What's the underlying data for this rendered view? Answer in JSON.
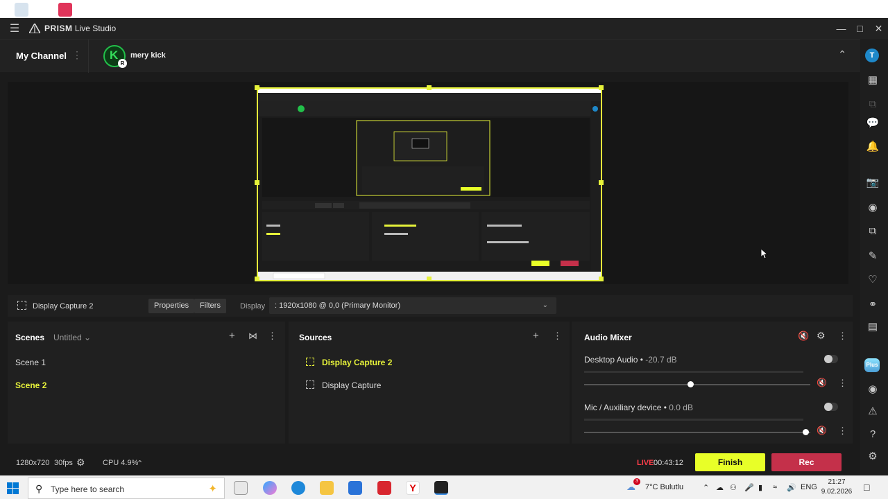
{
  "app": {
    "title_bold": "PRISM",
    "title_rest": " Live Studio"
  },
  "channel": {
    "label": "My Channel",
    "avatar_letter": "K",
    "avatar_badge": "R",
    "name": "mery kick"
  },
  "source_bar": {
    "source_name": "Display Capture 2",
    "properties_label": "Properties",
    "filters_label": "Filters",
    "display_label": "Display",
    "display_value": ": 1920x1080 @ 0,0 (Primary Monitor)"
  },
  "scenes": {
    "title": "Scenes",
    "collection": "Untitled",
    "items": [
      {
        "label": "Scene 1",
        "selected": false
      },
      {
        "label": "Scene 2",
        "selected": true
      }
    ]
  },
  "sources": {
    "title": "Sources",
    "items": [
      {
        "label": "Display Capture 2",
        "selected": true
      },
      {
        "label": "Display Capture",
        "selected": false
      }
    ]
  },
  "audio_mixer": {
    "title": "Audio Mixer",
    "channels": [
      {
        "name": "Desktop Audio",
        "level": "-20.7 dB",
        "volume": 0.47
      },
      {
        "name": "Mic / Auxiliary device",
        "level": "0.0 dB",
        "volume": 0.98
      }
    ]
  },
  "status": {
    "resolution": "1280x720",
    "fps": "30fps",
    "cpu": "CPU 4.9%",
    "live_label": "LIVE",
    "timer": "00:43:12",
    "finish_label": "Finish",
    "rec_label": "Rec"
  },
  "right_bar": {
    "avatar_letter": "T",
    "plus_label": "Plus"
  },
  "taskbar": {
    "search_placeholder": "Type here to search",
    "weather_badge": "3",
    "weather": "7°C  Bulutlu",
    "language": "ENG",
    "time": "21:27",
    "date": "9.02.2026"
  },
  "colors": {
    "accent_yellow": "#e8ff28",
    "rec_red": "#c4304a",
    "live_red": "#ff3e4a",
    "app_bg": "#1b1b1b"
  }
}
